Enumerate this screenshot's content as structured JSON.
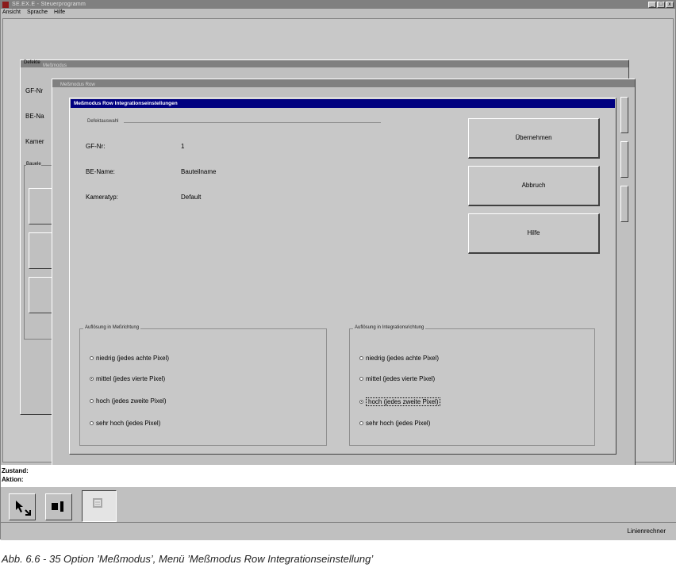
{
  "app": {
    "title": "SE.EX.E - Steuerprogramm",
    "menu": [
      "Ansicht",
      "Sprache",
      "Hilfe"
    ],
    "window_buttons": [
      "_",
      "□",
      "x"
    ]
  },
  "background_dialog": {
    "title": "Meßmodus",
    "tab": "Defekte",
    "labels": [
      "GF-Nr",
      "BE-Na",
      "Kamer"
    ],
    "group": "Bauele"
  },
  "background_dialog_row": {
    "title": "Meßmodus Row"
  },
  "dialog": {
    "title": "Meßmodus Row Integrationseinstellungen",
    "info_frame_label": "Defektauswahl",
    "info": [
      {
        "key": "GF-Nr:",
        "value": "1"
      },
      {
        "key": "BE-Name:",
        "value": "Bauteilname"
      },
      {
        "key": "Kameratyp:",
        "value": "Default"
      }
    ],
    "buttons": {
      "apply": "Übernehmen",
      "cancel": "Abbruch",
      "help": "Hilfe"
    },
    "group_measure": {
      "label": "Auflösung in Meßrichtung",
      "options": [
        "niedrig (jedes achte Pixel)",
        "mittel (jedes vierte Pixel)",
        "hoch (jedes zweite Pixel)",
        "sehr hoch (jedes Pixel)"
      ],
      "selected": "mittel (jedes vierte Pixel)"
    },
    "group_integration": {
      "label": "Auflösung in Integrationsrichtung",
      "options": [
        "niedrig (jedes achte Pixel)",
        "mittel (jedes vierte Pixel)",
        "hoch (jedes zweite Pixel)",
        "sehr hoch (jedes Pixel)"
      ],
      "selected": "hoch (jedes zweite Pixel)"
    }
  },
  "status": {
    "state_label": "Zustand:",
    "action_label": "Aktion:",
    "mode": "Linienrechner"
  },
  "tools": [
    "pointer-tool-icon",
    "bars-tool-icon",
    "disabled-tool-icon"
  ],
  "caption": "Abb. 6.6 - 35     Option ’Meßmodus’, Menü ’Meßmodus Row Integrationseinstellung’"
}
